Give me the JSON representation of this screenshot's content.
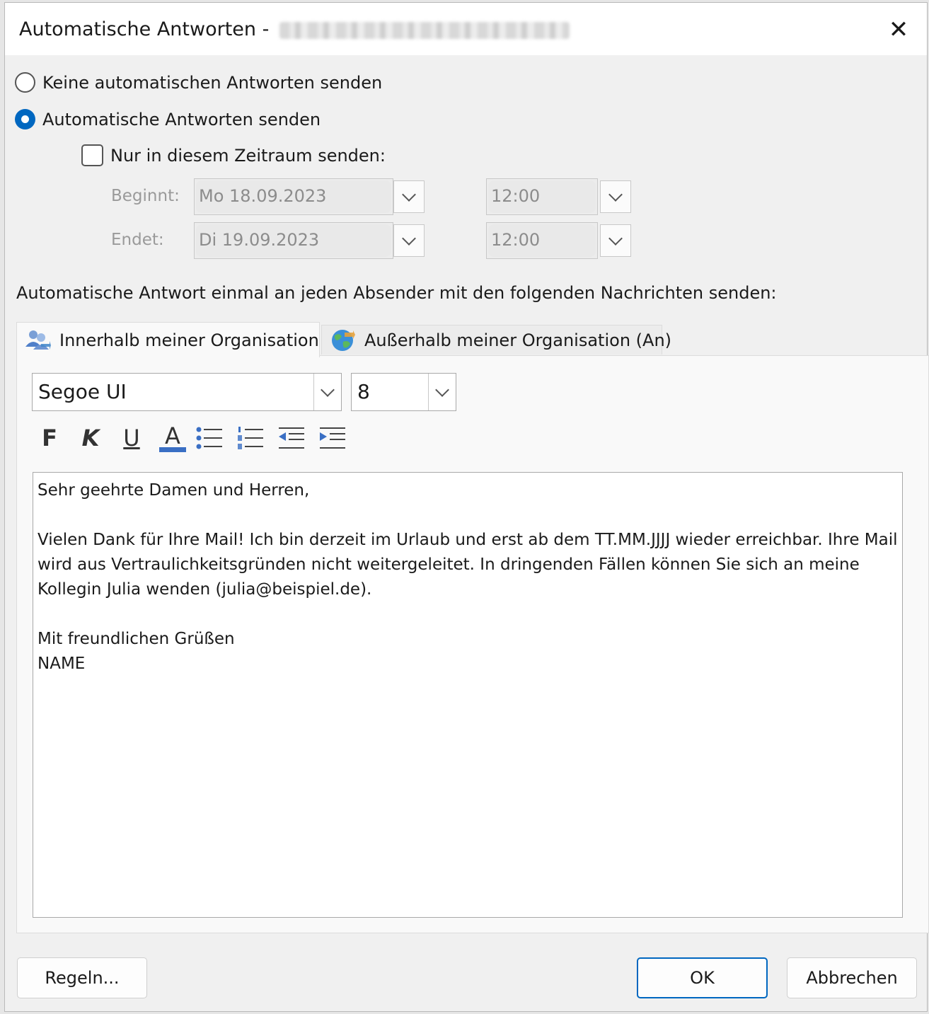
{
  "window": {
    "title": "Automatische Antworten -",
    "close_label": "✕"
  },
  "options": {
    "no_reply_label": "Keine automatischen Antworten senden",
    "send_reply_label": "Automatische Antworten senden",
    "send_reply_selected": true,
    "timerange_label": "Nur in diesem Zeitraum senden:",
    "timerange_checked": false
  },
  "timerange": {
    "start_label": "Beginnt:",
    "start_date": "Mo 18.09.2023",
    "start_time": "12:00",
    "end_label": "Endet:",
    "end_date": "Di 19.09.2023",
    "end_time": "12:00"
  },
  "section_label": "Automatische Antwort einmal an jeden Absender mit den folgenden Nachrichten senden:",
  "tabs": [
    {
      "label": "Innerhalb meiner Organisation",
      "icon": "people-icon",
      "active": true
    },
    {
      "label": "Außerhalb meiner Organisation (An)",
      "icon": "globe-icon",
      "active": false
    }
  ],
  "formatting": {
    "font_name": "Segoe UI",
    "font_size": "8",
    "bold_label": "F",
    "italic_label": "K",
    "underline_label": "U",
    "color_label": "A",
    "font_color": "#3a6fc4"
  },
  "message": {
    "line1": "Sehr geehrte Damen und Herren,",
    "line2": "Vielen Dank für Ihre Mail! Ich bin derzeit im Urlaub und erst ab dem TT.MM.JJJJ wieder erreichbar. Ihre Mail wird aus Vertraulichkeitsgründen nicht weitergeleitet. In dringenden Fällen können Sie sich an meine Kollegin Julia wenden (julia@beispiel.de).",
    "line3": "Mit freundlichen Grüßen",
    "line4": "NAME"
  },
  "buttons": {
    "rules_label": "Regeln...",
    "ok_label": "OK",
    "cancel_label": "Abbrechen"
  },
  "colors": {
    "accent": "#0067c0"
  }
}
